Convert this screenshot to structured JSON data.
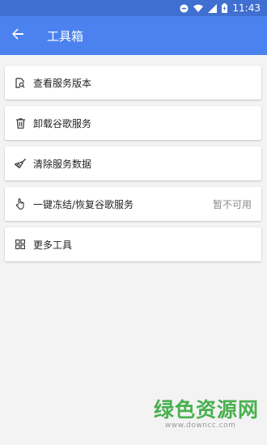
{
  "status_bar": {
    "time": "11:43",
    "icons": [
      "minus-circle-icon",
      "wifi-icon",
      "signal-icon",
      "battery-charging-icon"
    ]
  },
  "app_bar": {
    "back_icon": "arrow-left-icon",
    "title": "工具箱",
    "background": "#4b82ef"
  },
  "tools": [
    {
      "icon": "file-search-icon",
      "label": "查看服务版本",
      "status": ""
    },
    {
      "icon": "trash-icon",
      "label": "卸载谷歌服务",
      "status": ""
    },
    {
      "icon": "broom-icon",
      "label": "清除服务数据",
      "status": ""
    },
    {
      "icon": "touch-hand-icon",
      "label": "一键冻结/恢复谷歌服务",
      "status": "暂不可用"
    },
    {
      "icon": "grid-icon",
      "label": "更多工具",
      "status": ""
    }
  ],
  "watermark": {
    "main": "绿色资源网",
    "sub": "www.downcc.com",
    "color": "#49b04f"
  }
}
